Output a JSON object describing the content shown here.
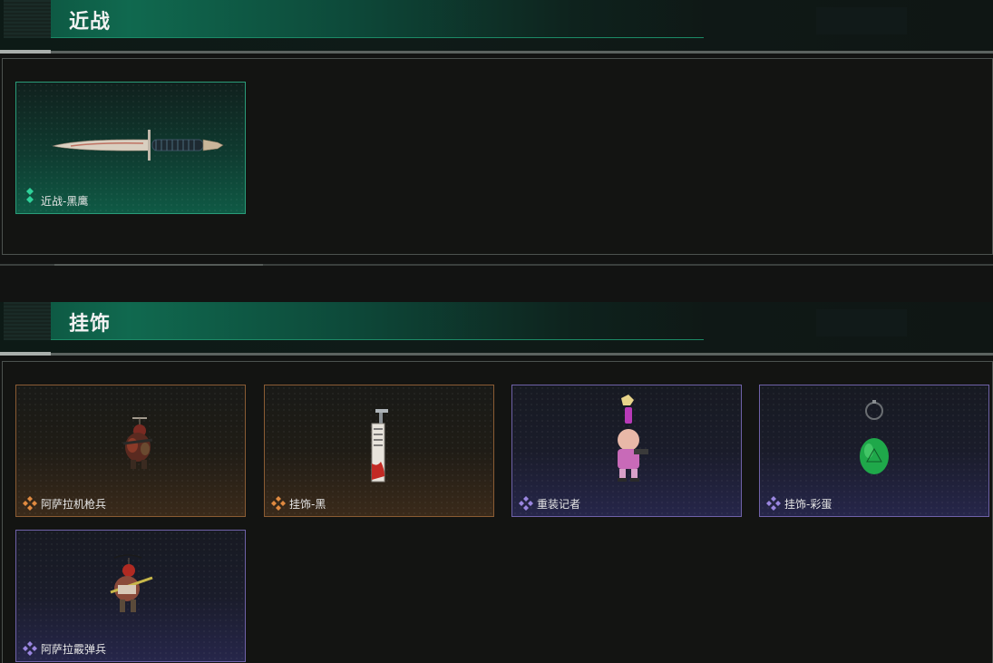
{
  "sections": [
    {
      "title": "近战",
      "items": [
        {
          "label": "近战-黑鹰",
          "rarity": "green",
          "rarity_icon": "double-diamond-icon",
          "art": "knife-icon"
        }
      ]
    },
    {
      "title": "挂饰",
      "items": [
        {
          "label": "阿萨拉机枪兵",
          "rarity": "orange",
          "rarity_icon": "quad-diamond-icon",
          "art": "machine-gunner-charm-icon"
        },
        {
          "label": "挂饰-黑",
          "rarity": "orange",
          "rarity_icon": "quad-diamond-icon",
          "art": "black-tag-charm-icon"
        },
        {
          "label": "重装记者",
          "rarity": "purple",
          "rarity_icon": "quad-diamond-icon",
          "art": "heavy-reporter-charm-icon"
        },
        {
          "label": "挂饰-彩蛋",
          "rarity": "purple",
          "rarity_icon": "quad-diamond-icon",
          "art": "easter-egg-charm-icon"
        },
        {
          "label": "阿萨拉霰弹兵",
          "rarity": "purple",
          "rarity_icon": "quad-diamond-icon",
          "art": "shotgunner-charm-icon"
        }
      ]
    }
  ],
  "colors": {
    "green": "#2a9c79",
    "orange": "#e08a40",
    "purple": "#9a86e0",
    "header_bar": "#10694f"
  }
}
